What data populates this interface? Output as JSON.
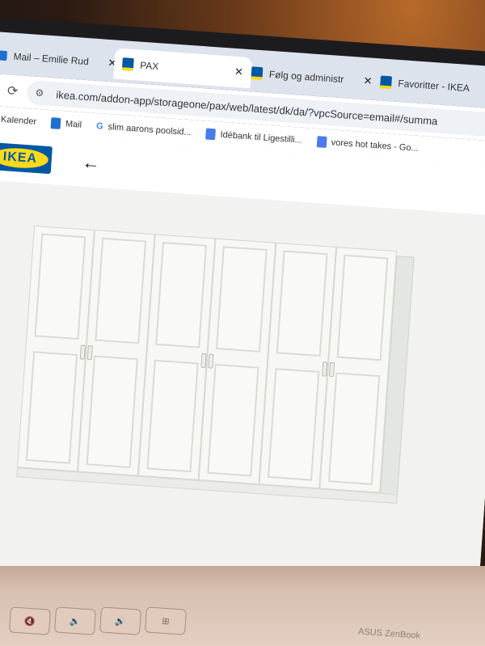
{
  "browser": {
    "tabs": [
      {
        "label": "Mail – Emilie Rud",
        "icon": "outlook-icon",
        "active": false
      },
      {
        "label": "PAX",
        "icon": "ikea-icon",
        "active": true
      },
      {
        "label": "Følg og administr",
        "icon": "ikea-icon",
        "active": false
      },
      {
        "label": "Favoritter - IKEA",
        "icon": "ikea-icon",
        "active": false
      }
    ],
    "close_glyph": "✕",
    "url": "ikea.com/addon-app/storageone/pax/web/latest/dk/da/?vpcSource=email#/summa",
    "bookmarks": [
      {
        "label": "oogle Kalender",
        "icon": "calendar-icon"
      },
      {
        "label": "Mail",
        "icon": "outlook-icon"
      },
      {
        "label": "slim aarons poolsid...",
        "icon": "google-icon"
      },
      {
        "label": "Idébank til Ligestilli...",
        "icon": "docs-icon"
      },
      {
        "label": "vores hot takes - Go...",
        "icon": "docs-icon"
      }
    ]
  },
  "ikea": {
    "logo_text": "IKEA",
    "back_glyph": "←"
  },
  "laptop": {
    "brand": "ASUS ZenBook",
    "keys": [
      "🔇",
      "🔉",
      "🔊",
      "⊞"
    ]
  },
  "colors": {
    "ikea_blue": "#0058a3",
    "ikea_yellow": "#ffda1a"
  }
}
